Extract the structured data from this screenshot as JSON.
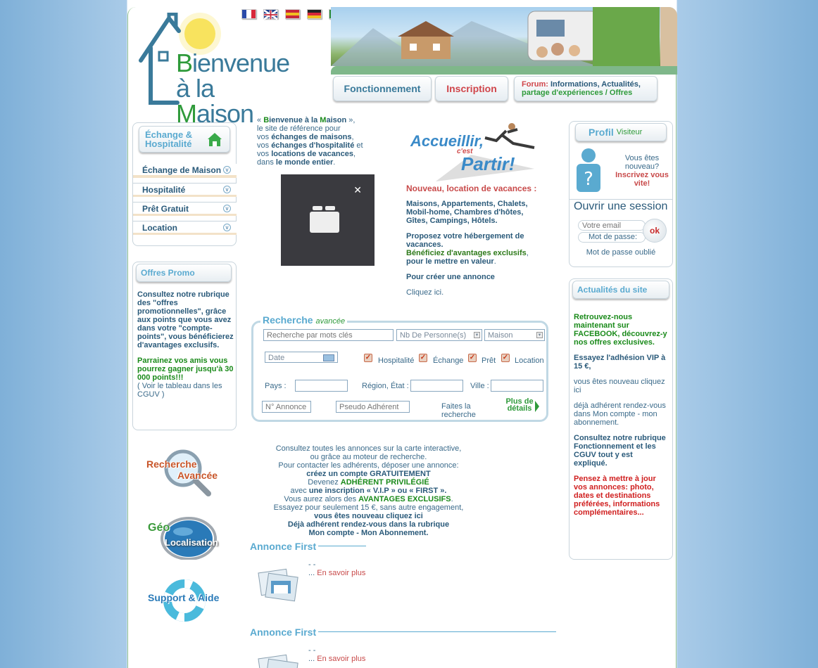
{
  "header": {
    "flags": [
      {
        "name": "flag-fr",
        "colors": [
          "#2a4aa8",
          "#ffffff",
          "#d8283a"
        ],
        "dir": "v"
      },
      {
        "name": "flag-uk",
        "colors": [
          "#1a3a8a",
          "#ffffff",
          "#c8283a"
        ],
        "dir": "uk"
      },
      {
        "name": "flag-es",
        "colors": [
          "#c8283a",
          "#f0c020",
          "#c8283a"
        ],
        "dir": "h"
      },
      {
        "name": "flag-de",
        "colors": [
          "#222222",
          "#d8283a",
          "#f0c020"
        ],
        "dir": "h"
      },
      {
        "name": "flag-it",
        "colors": [
          "#2a8a3a",
          "#ffffff",
          "#d8283a"
        ],
        "dir": "v"
      },
      {
        "name": "flag-pt",
        "colors": [
          "#2a7a2a",
          "#d8283a",
          "#d8283a"
        ],
        "dir": "v"
      }
    ],
    "logo_line1_pre": "B",
    "logo_line1": "ienvenue",
    "logo_line2_pre": "à la ",
    "logo_line2_m": "M",
    "logo_line2": "aison",
    "nav": {
      "fonctionnement": "Fonctionnement",
      "inscription": "Inscription",
      "forum_label": "Forum:",
      "forum_line1": "Informations, Actualités,",
      "forum_line2": "partage d'expériences / Offres"
    }
  },
  "left": {
    "exchange_title_1": "Échange &",
    "exchange_title_2": "Hospitalité",
    "menu": [
      {
        "label": "Échange de Maison"
      },
      {
        "label": "Hospitalité"
      },
      {
        "label": "Prêt Gratuit"
      },
      {
        "label": "Location"
      }
    ],
    "promo_title": "Offres Promo",
    "promo_text": "Consultez notre rubrique des \"offres promotionnelles\", grâce aux points que vous avez dans votre \"compte-points\", vous bénéficierez d'avantages exclusifs.",
    "promo_green": "Parrainez vos amis vous pourrez gagner jusqu'à 30 000 points!!!",
    "promo_link": "( Voir le tableau dans les CGUV )",
    "btn_recherche_1": "Recherche",
    "btn_recherche_2": "Avancée",
    "btn_geo_1": "Géo",
    "btn_geo_2": "Localisation",
    "btn_support": "Support & Aide"
  },
  "welcome": {
    "l1a": "« ",
    "l1b": "B",
    "l1c": "ienvenue à la ",
    "l1d": "M",
    "l1e": "aison",
    "l1f": " »,",
    "l2": "le site de référence pour",
    "l3a": "vos ",
    "l3b": "échanges de maisons",
    "l3c": ",",
    "l4a": "vos ",
    "l4b": "échanges d'hospitalité",
    "l4c": " et",
    "l5a": "vos ",
    "l5b": "locations de vacances",
    "l5c": ",",
    "l6a": "dans ",
    "l6b": "le monde entier",
    "l6c": "."
  },
  "media": {
    "close": "✕"
  },
  "accueil": {
    "t1": "Accueillir,",
    "t2": "c'est",
    "t3": "Partir!"
  },
  "right_info": {
    "title": "Nouveau, location de vacances :",
    "types": "Maisons, Appartements, Chalets, Mobil-home, Chambres d'hôtes, Gîtes, Campings, Hôtels.",
    "propose": "Proposez votre hébergement de vacances.",
    "benef": "Bénéficiez d'avantages exclusifs",
    "benef_end": ",",
    "valeur": "pour le mettre en valeur",
    "valeur_end": ".",
    "create": "Pour créer une annonce",
    "click": "Cliquez ici."
  },
  "search": {
    "title": "Recherche",
    "title_sub": "avancée",
    "keywords_placeholder": "Recherche par mots clés",
    "persons": "Nb De Personne(s)",
    "type": "Maison",
    "date": "Date",
    "opt_hosp": "Hospitalité",
    "opt_echange": "Échange",
    "opt_pret": "Prêt",
    "opt_location": "Location",
    "pays": "Pays :",
    "region": "Région, État :",
    "ville": "Ville :",
    "annonce_placeholder": "N° Annonce",
    "pseudo_placeholder": "Pseudo Adhérent",
    "faites": "Faites la",
    "recherche": "recherche",
    "plus": "Plus de",
    "details": "détails"
  },
  "info_center": {
    "l1": "Consultez toutes les annonces sur la carte interactive,",
    "l2": "ou grâce au moteur de recherche.",
    "l3": "Pour contacter les adhérents, déposer une annonce:",
    "l4": "créez un compte GRATUITEMENT",
    "l5a": "Devenez ",
    "l5b": "ADHÉRENT PRIVILÉGIÉ",
    "l6a": "avec ",
    "l6b": "une inscription « V.I.P » ou « FIRST ».",
    "l7a": "Vous aurez alors des ",
    "l7b": "AVANTAGES EXCLUSIFS",
    "l7c": ".",
    "l8": "Essayez pour seulement 15 €, sans autre engagement,",
    "l9": "vous êtes nouveau cliquez ici",
    "l10": "Déjà adhérent rendez-vous dans la rubrique",
    "l11": "Mon compte - Mon Abonnement."
  },
  "annonces": [
    {
      "title": "Annonce First",
      "dash": "- -",
      "dots": "... ",
      "link": "En savoir plus"
    },
    {
      "title": "Annonce First",
      "dash": "- -",
      "dots": "... ",
      "link": "En savoir plus"
    }
  ],
  "profil": {
    "title": "Profil",
    "visitor": "Visiteur",
    "msg1": "Vous êtes nouveau?",
    "msg2": "Inscrivez vous vite!",
    "session": "Ouvrir une session",
    "email_placeholder": "Votre email",
    "password_label": "Mot de passe:",
    "ok": "ok",
    "forgot": "Mot de passe oublié"
  },
  "actu": {
    "title": "Actualités du site",
    "p1": "Retrouvez-nous maintenant sur FACEBOOK, découvrez-y nos offres exclusives.",
    "p2": "Essayez l'adhésion VIP à 15 €,",
    "p3": "vous êtes nouveau cliquez ici",
    "p4": "déjà adhérent rendez-vous dans Mon compte - mon abonnement.",
    "p5": "Consultez notre rubrique Fonctionnement et les CGUV tout y est expliqué.",
    "p6": "Pensez à mettre à jour vos annonces: photo, dates et destinations préférées, informations complémentaires..."
  }
}
